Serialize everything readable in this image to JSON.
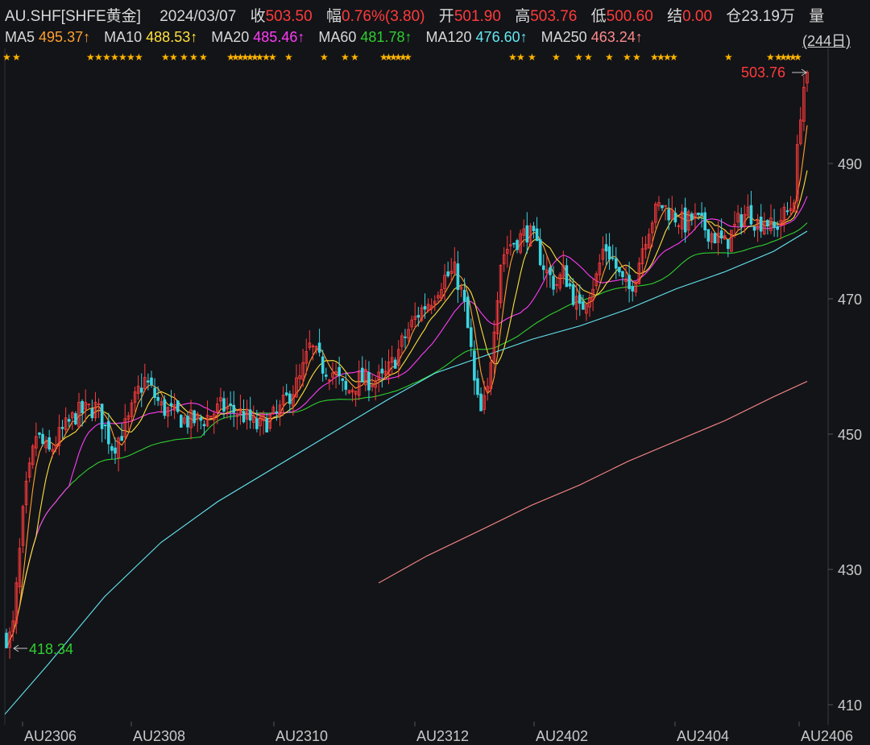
{
  "header": {
    "symbol": "AU.SHF[SHFE黄金]",
    "date": "2024/03/07",
    "close_label": "收",
    "close": "503.50",
    "change_label": "幅",
    "change": "0.76%(3.80)",
    "open_label": "开",
    "open": "501.90",
    "high_label": "高",
    "high": "503.76",
    "low_label": "低",
    "low": "500.60",
    "settle_label": "结",
    "settle": "0.00",
    "oi_label": "仓",
    "oi": "23.19万",
    "volume_label": "量"
  },
  "ma_legend": [
    {
      "label": "MA5",
      "value": "495.37↑",
      "color": "#ff9f2e"
    },
    {
      "label": "MA10",
      "value": "488.53↑",
      "color": "#ffe13a"
    },
    {
      "label": "MA20",
      "value": "485.46↑",
      "color": "#ff3df6"
    },
    {
      "label": "MA60",
      "value": "481.78↑",
      "color": "#2fcf2f"
    },
    {
      "label": "MA120",
      "value": "476.60↑",
      "color": "#64e7f2"
    },
    {
      "label": "MA250",
      "value": "463.24↑",
      "color": "#ff8a8a"
    }
  ],
  "range_label": "(244日)",
  "chart_data": {
    "type": "candlestick",
    "y_ticks": [
      410,
      430,
      450,
      470,
      490
    ],
    "ylim": [
      408,
      507
    ],
    "x_ticks": [
      "AU2306",
      "AU2308",
      "AU2310",
      "AU2312",
      "AU2402",
      "AU2404",
      "AU2406"
    ],
    "high_annotation": "503.76",
    "low_annotation": "418.34",
    "up_color": "#ff3b3b",
    "down_color": "#3ad4e0"
  }
}
